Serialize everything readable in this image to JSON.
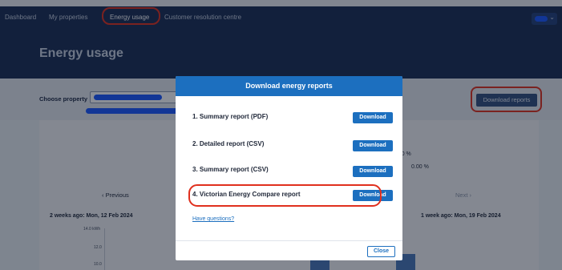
{
  "nav": {
    "items": [
      "Dashboard",
      "My properties",
      "Energy usage",
      "Customer resolution centre"
    ],
    "active_index": 2
  },
  "page": {
    "title": "Energy usage"
  },
  "filter": {
    "choose_property_label": "Choose property",
    "download_reports_label": "Download reports"
  },
  "card": {
    "change_value": "+58.10 %",
    "zero_value": "0.00 %",
    "prev_label": "‹  Previous",
    "next_label": "Next  ›",
    "left_week": "2 weeks ago: Mon, 12 Feb 2024",
    "right_week": "1 week ago: Mon, 19 Feb 2024",
    "ticks": [
      "14.0 kWh",
      "12.0",
      "10.0"
    ]
  },
  "modal": {
    "title": "Download energy reports",
    "reports": [
      {
        "label": "1. Summary report (PDF)",
        "button": "Download"
      },
      {
        "label": "2. Detailed report (CSV)",
        "button": "Download"
      },
      {
        "label": "3. Summary report (CSV)",
        "button": "Download"
      },
      {
        "label": "4. Victorian Energy Compare report",
        "button": "Download"
      }
    ],
    "questions_link": "Have questions?",
    "close_label": "Close"
  },
  "colors": {
    "nav_bg": "#1a2d54",
    "primary": "#1c6fbf",
    "highlight": "#e0301e",
    "redacted": "#1a56ff"
  }
}
